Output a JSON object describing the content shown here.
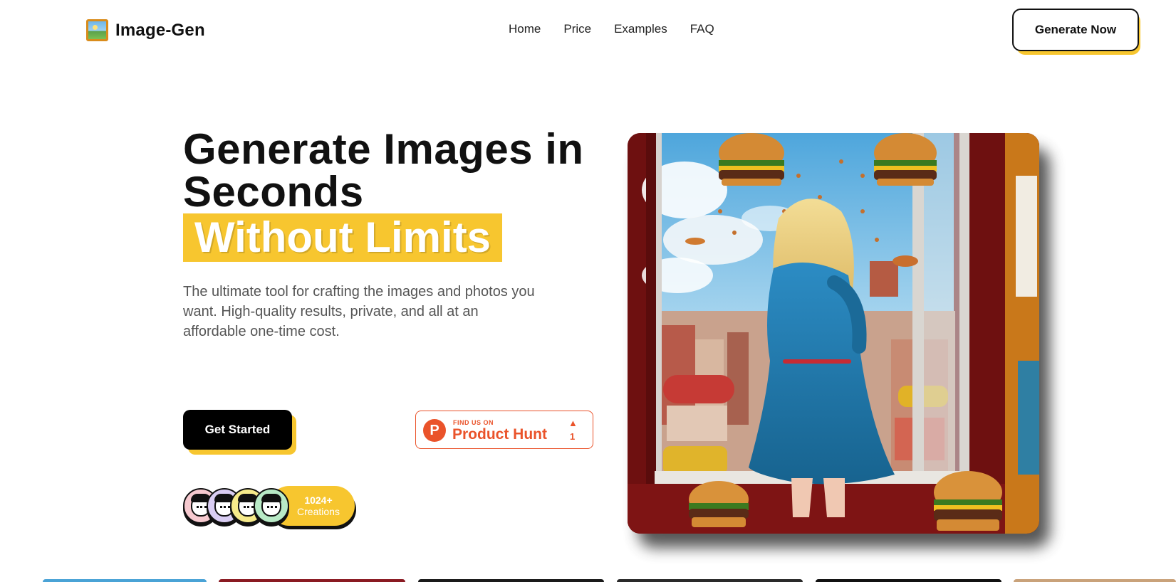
{
  "header": {
    "logo_text": "Image-Gen",
    "logo_icon": "framed-picture-icon",
    "nav": [
      "Home",
      "Price",
      "Examples",
      "FAQ"
    ],
    "cta_label": "Generate Now"
  },
  "hero": {
    "title": "Generate Images in Seconds",
    "highlight": "Without Limits",
    "description": "The ultimate tool for crafting the images and photos you want. High-quality results, private, and all at an affordable one-time cost.",
    "get_started_label": "Get Started",
    "product_hunt": {
      "small_label": "FIND US ON",
      "big_label": "Product Hunt",
      "logo_letter": "P",
      "upvote_icon": "triangle-up-icon",
      "count": "1"
    },
    "creations": {
      "count": "1024+",
      "label": "Creations"
    },
    "avatar_colors": [
      "#f6c9cf",
      "#d9cdf3",
      "#f6ea8a",
      "#b8eac6"
    ]
  },
  "colors": {
    "accent": "#f7c62f",
    "dark": "#111111",
    "product_hunt": "#ea532a"
  }
}
